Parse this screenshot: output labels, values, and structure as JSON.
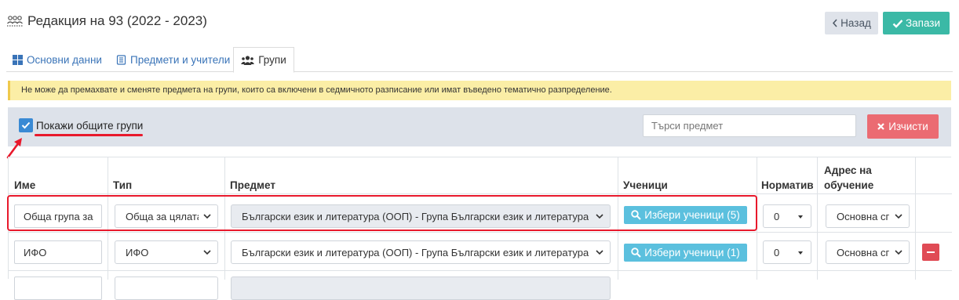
{
  "header": {
    "title": "Редакция на 93 (2022 - 2023)",
    "title_icon": "people-group-icon",
    "back_label": "Назад",
    "save_label": "Запази"
  },
  "tabs": [
    {
      "label": "Основни данни",
      "icon": "grid-icon",
      "active": false
    },
    {
      "label": "Предмети и учители",
      "icon": "book-icon",
      "active": false
    },
    {
      "label": "Групи",
      "icon": "users-icon",
      "active": true
    }
  ],
  "alert": {
    "text": "Не може да премахвате и сменяте предмета на групи, които са включени в седмичното разписание или имат въведено тематично разпределение."
  },
  "filter": {
    "show_common_label": "Покажи общите групи",
    "show_common_checked": true,
    "search_placeholder": "Търси предмет",
    "search_value": "",
    "clear_label": "Изчисти"
  },
  "table": {
    "headers": {
      "name": "Име",
      "type": "Тип",
      "subject": "Предмет",
      "students": "Ученици",
      "norm": "Норматив",
      "address": "Адрес на обучение"
    },
    "rows": [
      {
        "name": "Обща група за",
        "type": "Обща за цялата",
        "subject": "Български език и литература (ООП) - Група Български език и литература",
        "students": "Избери ученици (5)",
        "norm": "0",
        "address": "Основна сграда",
        "removable": false
      },
      {
        "name": "ИФО",
        "type": "ИФО",
        "subject": "Български език и литература (ООП) - Група Български език и литература",
        "students": "Избери ученици (1)",
        "norm": "0",
        "address": "Основна сграда",
        "removable": true
      }
    ]
  },
  "colors": {
    "accent": "#3bb9a6",
    "link": "#3a74b8",
    "danger": "#eb6b72",
    "info": "#5bc0de",
    "alert_bg": "#fbeea6",
    "annotation": "#e8192c"
  }
}
